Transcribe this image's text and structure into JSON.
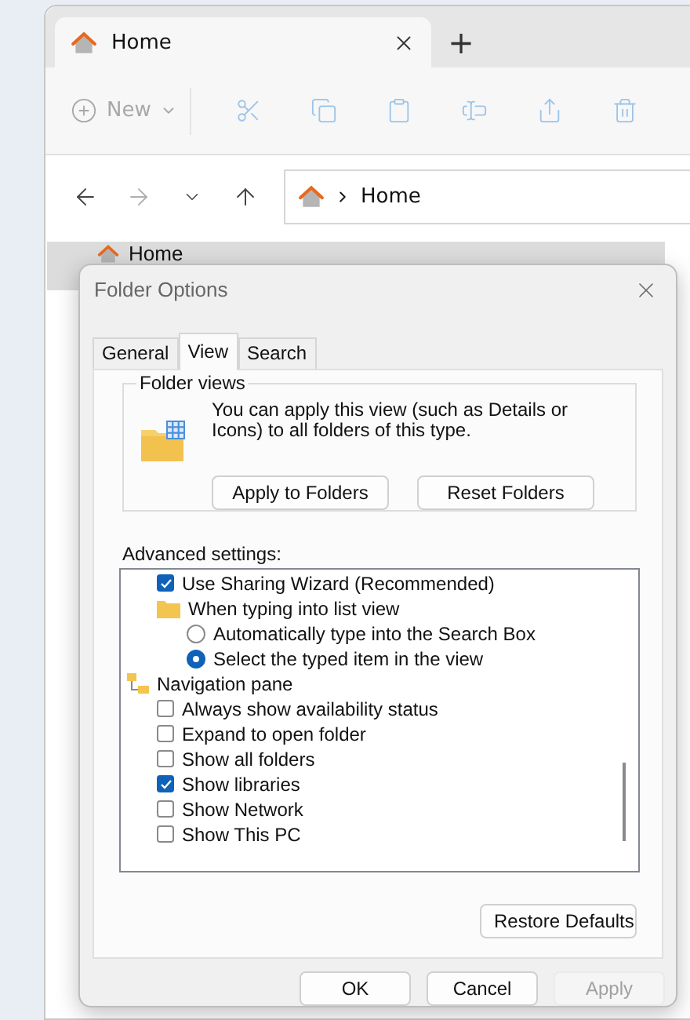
{
  "explorer": {
    "tabs": [
      {
        "label": "Home",
        "selected": true
      }
    ],
    "new_tab_button": "+",
    "toolbar": {
      "new_button": {
        "label": "New",
        "disabled": true
      },
      "actions": [
        {
          "kind": "cut",
          "disabled": true
        },
        {
          "kind": "copy",
          "disabled": true
        },
        {
          "kind": "paste",
          "disabled": true
        },
        {
          "kind": "rename",
          "disabled": true
        },
        {
          "kind": "share",
          "disabled": true
        },
        {
          "kind": "delete",
          "disabled": true
        }
      ]
    },
    "nav": [
      {
        "kind": "back",
        "disabled": false
      },
      {
        "kind": "forward",
        "disabled": true
      },
      {
        "kind": "recent",
        "disabled": false
      },
      {
        "kind": "up",
        "disabled": false
      }
    ],
    "address": {
      "crumbs": [
        "Home"
      ]
    },
    "sidebar": {
      "items": [
        {
          "label": "Home",
          "selected": true
        }
      ]
    }
  },
  "dialog": {
    "title": "Folder Options",
    "tabs": [
      {
        "label": "General",
        "selected": false
      },
      {
        "label": "View",
        "selected": true
      },
      {
        "label": "Search",
        "selected": false
      }
    ],
    "folder_views": {
      "title": "Folder views",
      "text": "You can apply this view (such as Details or Icons) to all folders of this type.",
      "buttons": [
        "Apply to Folders",
        "Reset Folders"
      ]
    },
    "advanced": {
      "label": "Advanced settings:",
      "settings": [
        {
          "kind": "checkbox",
          "label": "Use Sharing Wizard (Recommended)",
          "checked": true
        },
        {
          "kind": "folder",
          "label": "When typing into list view",
          "children": [
            {
              "kind": "radio",
              "label": "Automatically type into the Search Box",
              "selected": false
            },
            {
              "kind": "radio",
              "label": "Select the typed item in the view",
              "selected": true
            }
          ]
        },
        {
          "kind": "section",
          "label": "Navigation pane",
          "children": [
            {
              "kind": "checkbox",
              "label": "Always show availability status",
              "checked": false
            },
            {
              "kind": "checkbox",
              "label": "Expand to open folder",
              "checked": false
            },
            {
              "kind": "checkbox",
              "label": "Show all folders",
              "checked": false
            },
            {
              "kind": "checkbox",
              "label": "Show libraries",
              "checked": true
            },
            {
              "kind": "checkbox",
              "label": "Show Network",
              "checked": false
            },
            {
              "kind": "checkbox",
              "label": "Show This PC",
              "checked": false
            }
          ]
        }
      ]
    },
    "restore_button": "Restore Defaults",
    "buttons": [
      {
        "label": "OK",
        "disabled": false
      },
      {
        "label": "Cancel",
        "disabled": false
      },
      {
        "label": "Apply",
        "disabled": true
      }
    ]
  }
}
